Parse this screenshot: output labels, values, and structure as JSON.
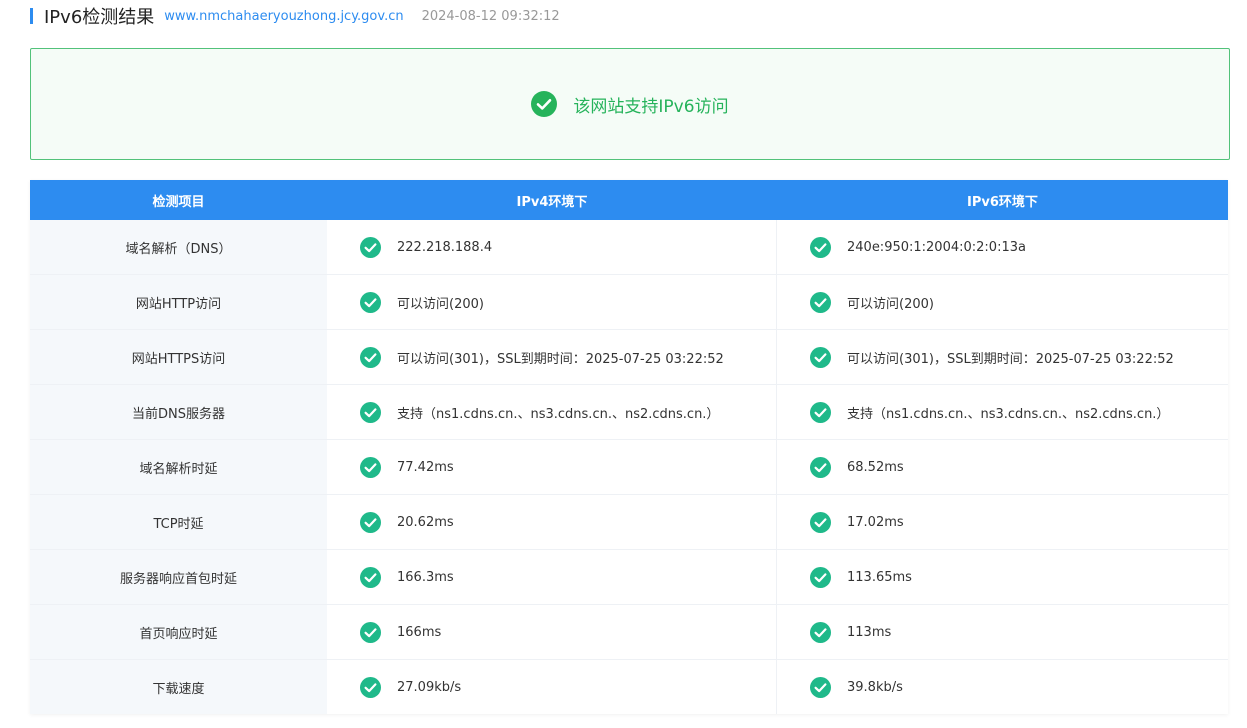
{
  "header": {
    "title": "IPv6检测结果",
    "domain": "www.nmchahaeryouzhong.jcy.gov.cn",
    "timestamp": "2024-08-12 09:32:12"
  },
  "banner": {
    "icon": "check-circle-icon",
    "text": "该网站支持IPv6访问",
    "color": "#26b35b"
  },
  "table": {
    "headers": {
      "item": "检测项目",
      "ipv4": "IPv4环境下",
      "ipv6": "IPv6环境下"
    },
    "header_color": "#2d8cf0",
    "status_icon": "check-circle-icon",
    "status_color": "#1fb98a",
    "rows": [
      {
        "item": "域名解析（DNS）",
        "ipv4": "222.218.188.4",
        "ipv6": "240e:950:1:2004:0:2:0:13a"
      },
      {
        "item": "网站HTTP访问",
        "ipv4": "可以访问(200)",
        "ipv6": "可以访问(200)"
      },
      {
        "item": "网站HTTPS访问",
        "ipv4": "可以访问(301)，SSL到期时间：2025-07-25 03:22:52",
        "ipv6": "可以访问(301)，SSL到期时间：2025-07-25 03:22:52"
      },
      {
        "item": "当前DNS服务器",
        "ipv4": "支持（ns1.cdns.cn.、ns3.cdns.cn.、ns2.cdns.cn.）",
        "ipv6": "支持（ns1.cdns.cn.、ns3.cdns.cn.、ns2.cdns.cn.）"
      },
      {
        "item": "域名解析时延",
        "ipv4": "77.42ms",
        "ipv6": "68.52ms"
      },
      {
        "item": "TCP时延",
        "ipv4": "20.62ms",
        "ipv6": "17.02ms"
      },
      {
        "item": "服务器响应首包时延",
        "ipv4": "166.3ms",
        "ipv6": "113.65ms"
      },
      {
        "item": "首页响应时延",
        "ipv4": "166ms",
        "ipv6": "113ms"
      },
      {
        "item": "下载速度",
        "ipv4": "27.09kb/s",
        "ipv6": "39.8kb/s"
      }
    ]
  }
}
